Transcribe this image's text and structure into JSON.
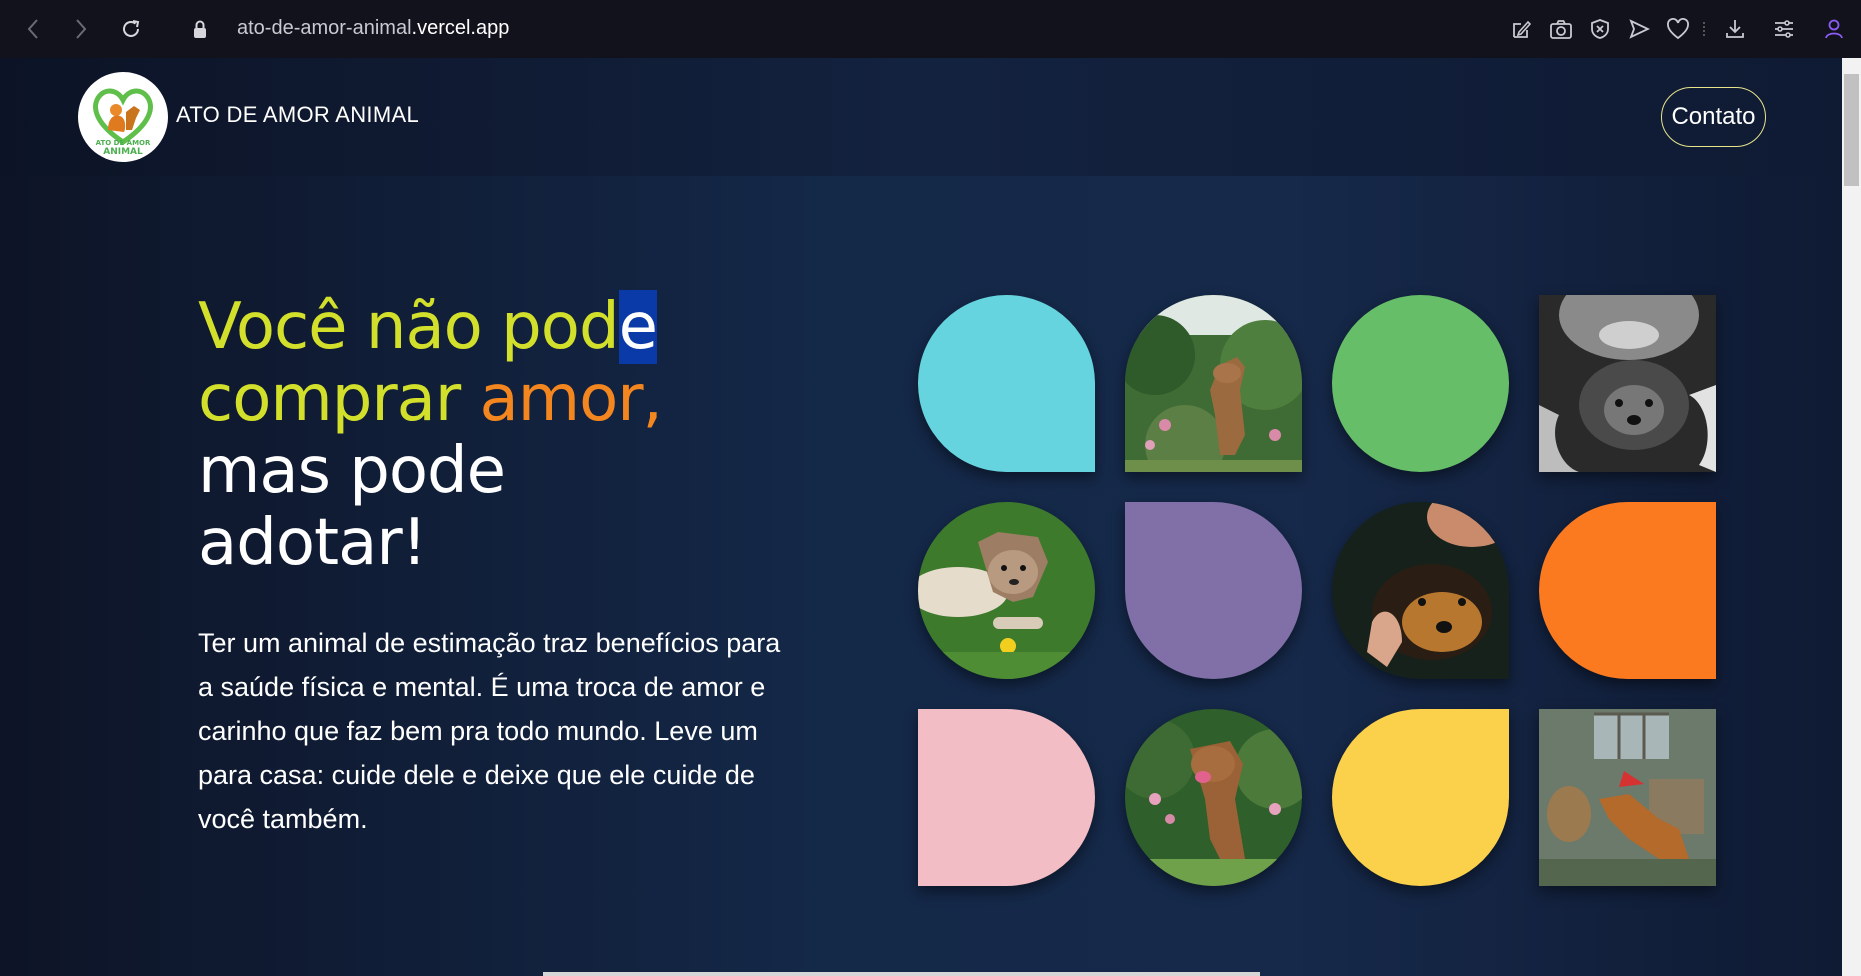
{
  "browser": {
    "url_prefix": "ato-de-amor-animal",
    "url_domain": ".vercel.app",
    "icons": [
      "back-icon",
      "forward-icon",
      "reload-icon",
      "lock-icon",
      "edit-page-icon",
      "camera-icon",
      "shield-x-icon",
      "send-icon",
      "heart-icon",
      "download-icon",
      "settings-sliders-icon",
      "profile-icon"
    ]
  },
  "header": {
    "brand": "ATO DE AMOR ANIMAL",
    "logo_text_line1": "ATO DE AMOR",
    "logo_text_line2": "ANIMAL",
    "contact_label": "Contato"
  },
  "hero": {
    "title_part1": "Você não pod",
    "title_selected": "e",
    "title_part2": "comprar ",
    "title_part3": "amor,",
    "title_part4": "mas pode",
    "title_part5": "adotar!",
    "text": "Ter um animal de estimação traz benefícios para a saúde física e mental. É uma troca de amor e carinho que faz bem pra todo mundo. Leve um para casa: cuide dele e deixe que ele cuide de você também."
  },
  "grid": {
    "tiles": [
      {
        "kind": "color",
        "color": "#66d4de",
        "shape": "drop-br"
      },
      {
        "kind": "photo",
        "subject": "dog-garden-photo",
        "shape": "dome"
      },
      {
        "kind": "color",
        "color": "#66bf68",
        "shape": "circle"
      },
      {
        "kind": "photo",
        "subject": "person-puppy-bw-photo",
        "shape": "square"
      },
      {
        "kind": "photo",
        "subject": "puppy-grass-photo",
        "shape": "circle"
      },
      {
        "kind": "color",
        "color": "#8170a8",
        "shape": "drop-tl"
      },
      {
        "kind": "photo",
        "subject": "dog-hand-photo",
        "shape": "drop-br"
      },
      {
        "kind": "color",
        "color": "#fb7a20",
        "shape": "half-left"
      },
      {
        "kind": "color",
        "color": "#f3bdc6",
        "shape": "half-right"
      },
      {
        "kind": "photo",
        "subject": "dog-lawn-photo",
        "shape": "circle"
      },
      {
        "kind": "color",
        "color": "#fbd14b",
        "shape": "drop-tr"
      },
      {
        "kind": "photo",
        "subject": "dog-house-photo",
        "shape": "square"
      }
    ]
  }
}
